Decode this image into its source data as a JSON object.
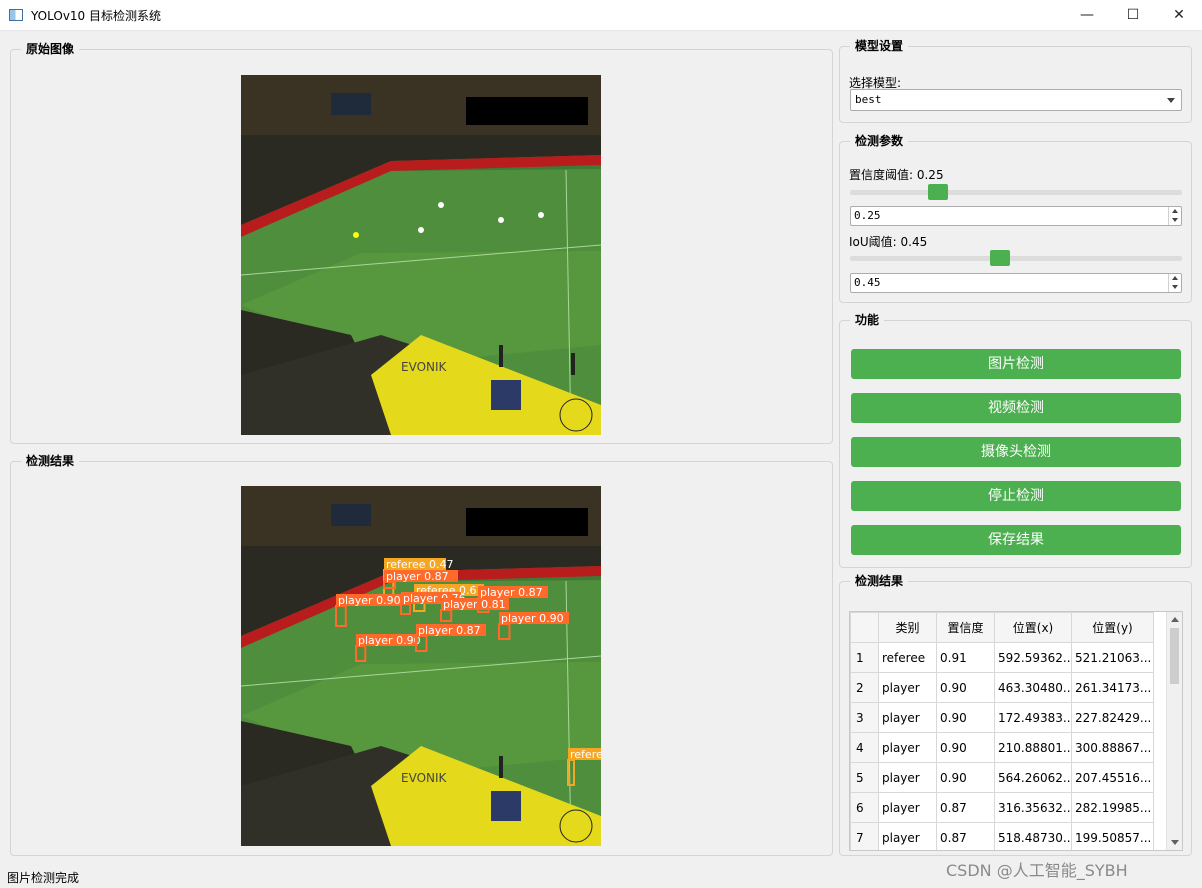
{
  "window": {
    "title": "YOLOv10 目标检测系统",
    "minimize_glyph": "—",
    "maximize_glyph": "☐",
    "close_glyph": "✕"
  },
  "original_panel": {
    "title": "原始图像"
  },
  "result_panel": {
    "title": "检测结果"
  },
  "detections_overlay": [
    {
      "text": "referee 0.47",
      "color": "#f5a623"
    },
    {
      "text": "player 0.87",
      "color": "#ff6a2b"
    },
    {
      "text": "referee 0.6",
      "color": "#f5a623"
    },
    {
      "text": "player 0.90",
      "color": "#ff6a2b"
    },
    {
      "text": "player 0.76",
      "color": "#ff6a2b"
    },
    {
      "text": "player 0.81",
      "color": "#ff6a2b"
    },
    {
      "text": "player 0.87",
      "color": "#ff6a2b"
    },
    {
      "text": "player 0.90",
      "color": "#ff6a2b"
    },
    {
      "text": "player 0.90",
      "color": "#ff6a2b"
    },
    {
      "text": "player 0.87",
      "color": "#ff6a2b"
    },
    {
      "text": "referee",
      "color": "#f5a623"
    }
  ],
  "model_settings": {
    "title": "模型设置",
    "select_label": "选择模型:",
    "selected_model": "best"
  },
  "params": {
    "title": "检测参数",
    "conf_label": "置信度阈值: 0.25",
    "conf_value": "0.25",
    "conf_fraction": 0.25,
    "iou_label": "IoU阈值: 0.45",
    "iou_value": "0.45",
    "iou_fraction": 0.45
  },
  "functions": {
    "title": "功能",
    "image_detect": "图片检测",
    "video_detect": "视频检测",
    "camera_detect": "摄像头检测",
    "stop_detect": "停止检测",
    "save_result": "保存结果"
  },
  "results_table": {
    "title": "检测结果",
    "headers": [
      "类别",
      "置信度",
      "位置(x)",
      "位置(y)"
    ],
    "rows": [
      [
        "1",
        "referee",
        "0.91",
        "592.59362...",
        "521.21063..."
      ],
      [
        "2",
        "player",
        "0.90",
        "463.30480...",
        "261.34173..."
      ],
      [
        "3",
        "player",
        "0.90",
        "172.49383...",
        "227.82429..."
      ],
      [
        "4",
        "player",
        "0.90",
        "210.88801...",
        "300.88867..."
      ],
      [
        "5",
        "player",
        "0.90",
        "564.26062...",
        "207.45516..."
      ],
      [
        "6",
        "player",
        "0.87",
        "316.35632...",
        "282.19985..."
      ],
      [
        "7",
        "player",
        "0.87",
        "518.48730...",
        "199.50857..."
      ]
    ]
  },
  "status_bar": {
    "text": "图片检测完成"
  },
  "watermark": "CSDN @人工智能_SYBH",
  "colors": {
    "accent": "#4caf50",
    "box_orange": "#ff6a2b",
    "box_yellow": "#f5a623"
  }
}
